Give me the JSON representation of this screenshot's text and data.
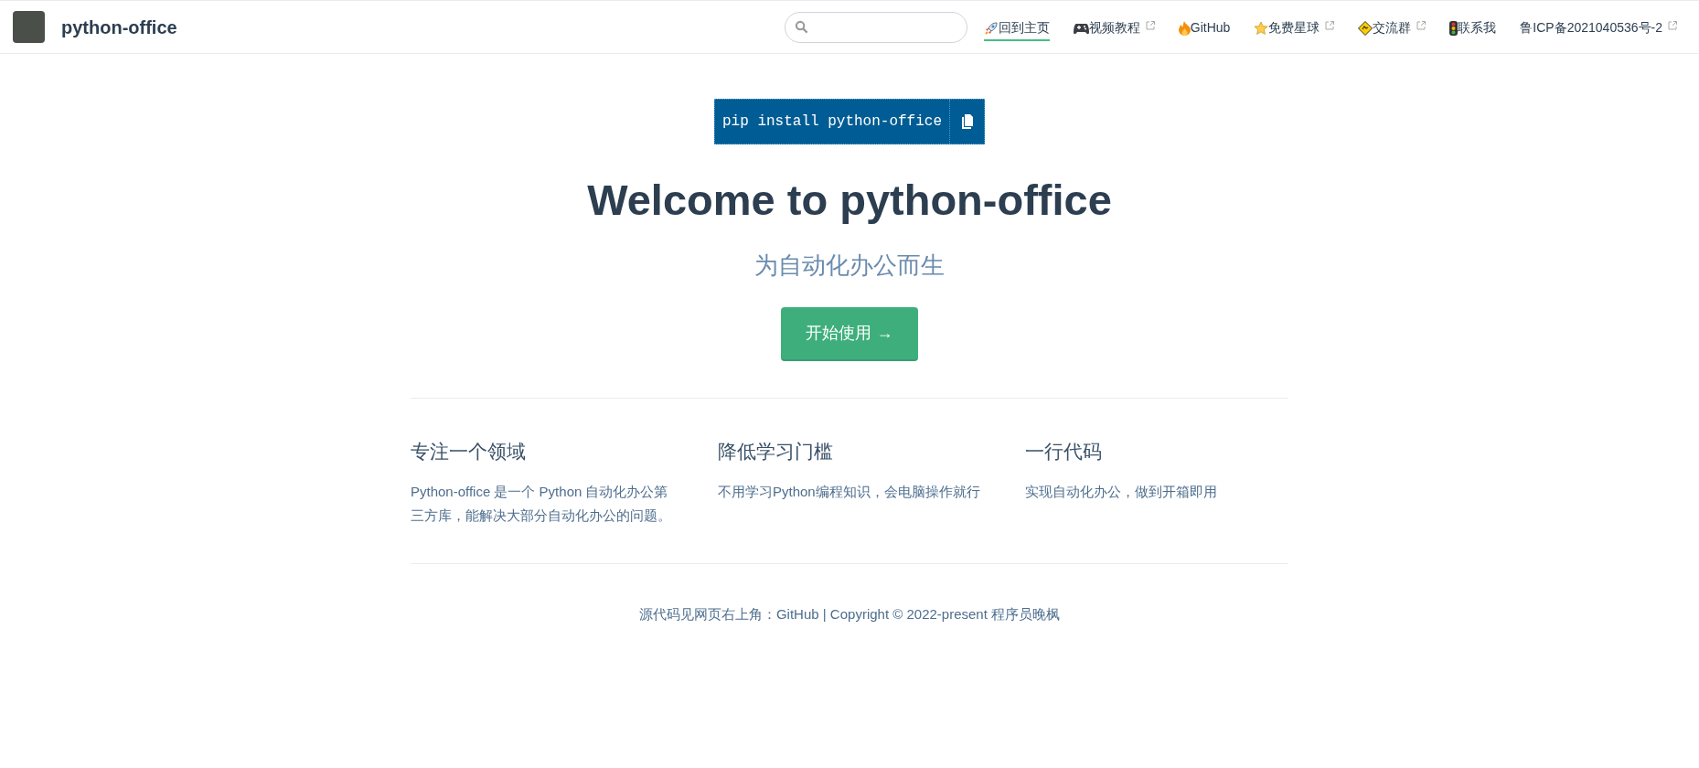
{
  "navbar": {
    "site_title": "python-office",
    "links": [
      {
        "label": "回到主页",
        "selected": true,
        "external": false
      },
      {
        "label": "视频教程",
        "selected": false,
        "external": true
      },
      {
        "label": "GitHub",
        "selected": false,
        "external": false
      },
      {
        "label": "免费星球",
        "selected": false,
        "external": true
      },
      {
        "label": "交流群",
        "selected": false,
        "external": true
      },
      {
        "label": "联系我",
        "selected": false,
        "external": false
      },
      {
        "label": "鲁ICP备2021040536号-2",
        "selected": false,
        "external": true
      }
    ]
  },
  "hero": {
    "install_command": "pip install python-office",
    "title": "Welcome to python-office",
    "tagline": "为自动化办公而生",
    "action": "开始使用 →"
  },
  "features": [
    {
      "title": "专注一个领域",
      "details": "Python-office 是一个 Python 自动化办公第三方库，能解决大部分自动化办公的问题。"
    },
    {
      "title": "降低学习门槛",
      "details": "不用学习Python编程知识，会电脑操作就行"
    },
    {
      "title": "一行代码",
      "details": "实现自动化办公，做到开箱即用"
    }
  ],
  "footer": "源代码见网页右上角：GitHub | Copyright © 2022-present 程序员晚枫"
}
